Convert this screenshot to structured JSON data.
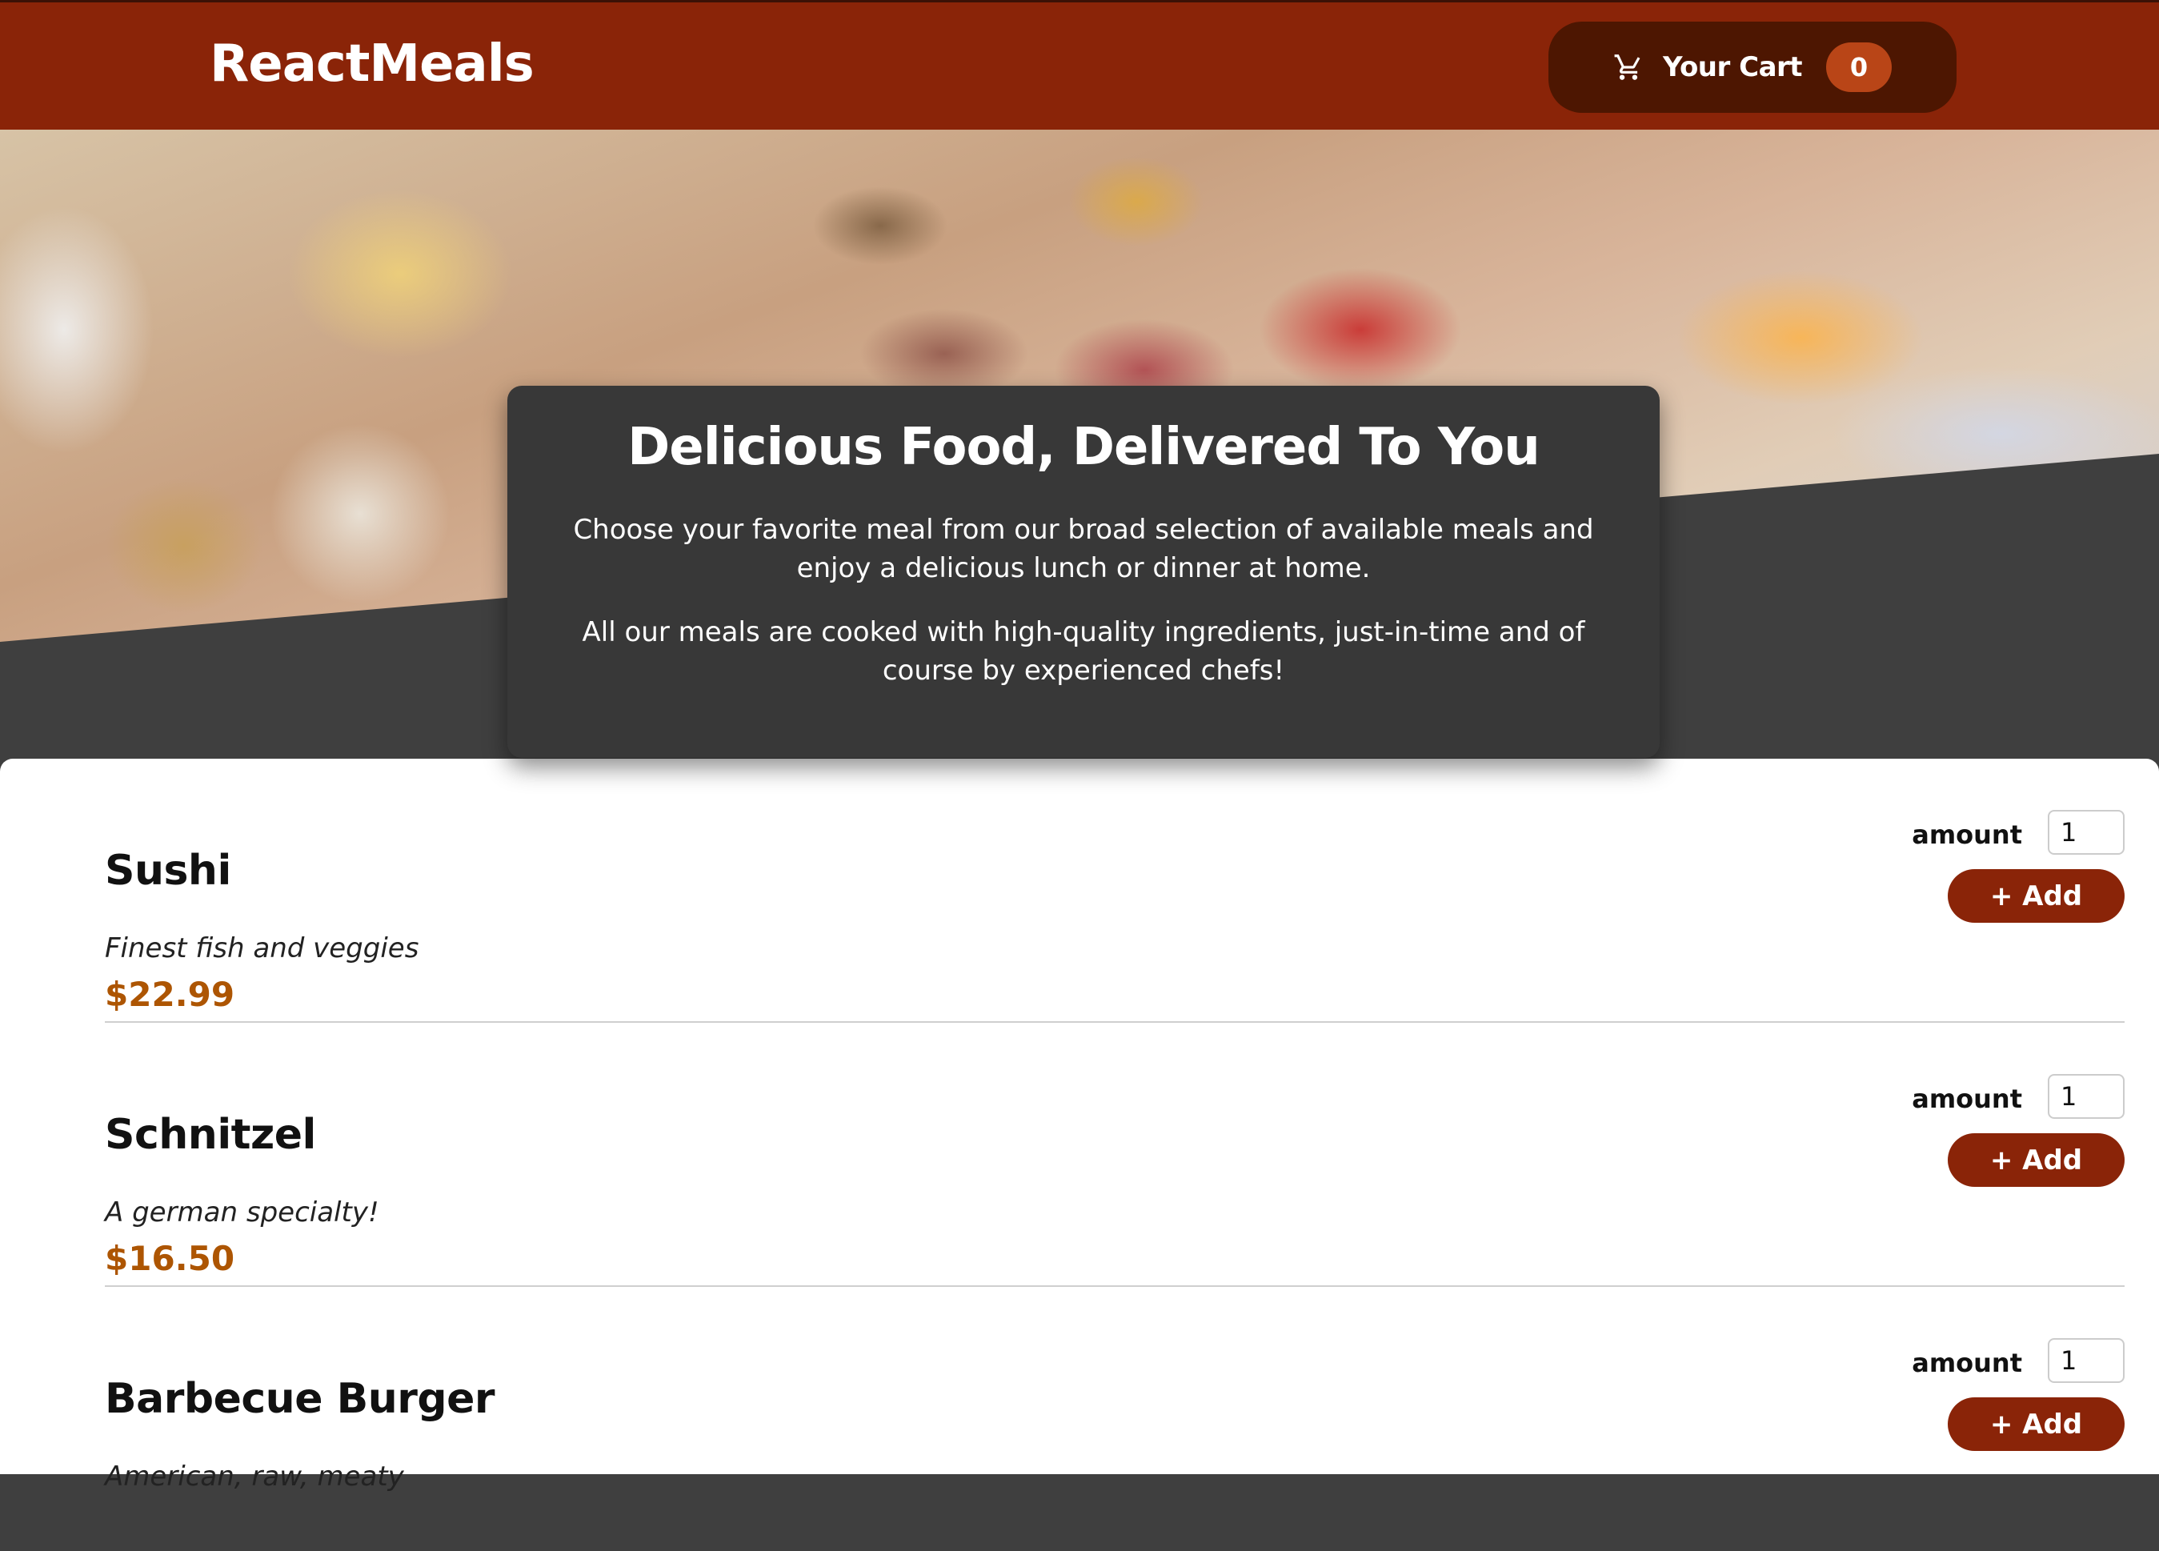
{
  "header": {
    "logo": "ReactMeals",
    "cart": {
      "label": "Your Cart",
      "count": "0",
      "icon": "cart-icon"
    }
  },
  "summary": {
    "title": "Delicious Food, Delivered To You",
    "paragraph1": "Choose your favorite meal from our broad selection of available meals and enjoy a delicious lunch or dinner at home.",
    "paragraph2": "All our meals are cooked with high-quality ingredients, just-in-time and of course by experienced chefs!"
  },
  "meals": [
    {
      "name": "Sushi",
      "description": "Finest fish and veggies",
      "price": "$22.99",
      "amount_label": "amount",
      "amount_value": "1",
      "add_label": "+ Add"
    },
    {
      "name": "Schnitzel",
      "description": "A german specialty!",
      "price": "$16.50",
      "amount_label": "amount",
      "amount_value": "1",
      "add_label": "+ Add"
    },
    {
      "name": "Barbecue Burger",
      "description": "American, raw, meaty",
      "price": "",
      "amount_label": "amount",
      "amount_value": "1",
      "add_label": "+ Add"
    }
  ],
  "colors": {
    "header_bg": "#8a2408",
    "cart_button_bg": "#4d1601",
    "cart_badge_bg": "#b94517",
    "price": "#ad5502",
    "add_button_bg": "#8a2408",
    "summary_bg": "#383838"
  }
}
